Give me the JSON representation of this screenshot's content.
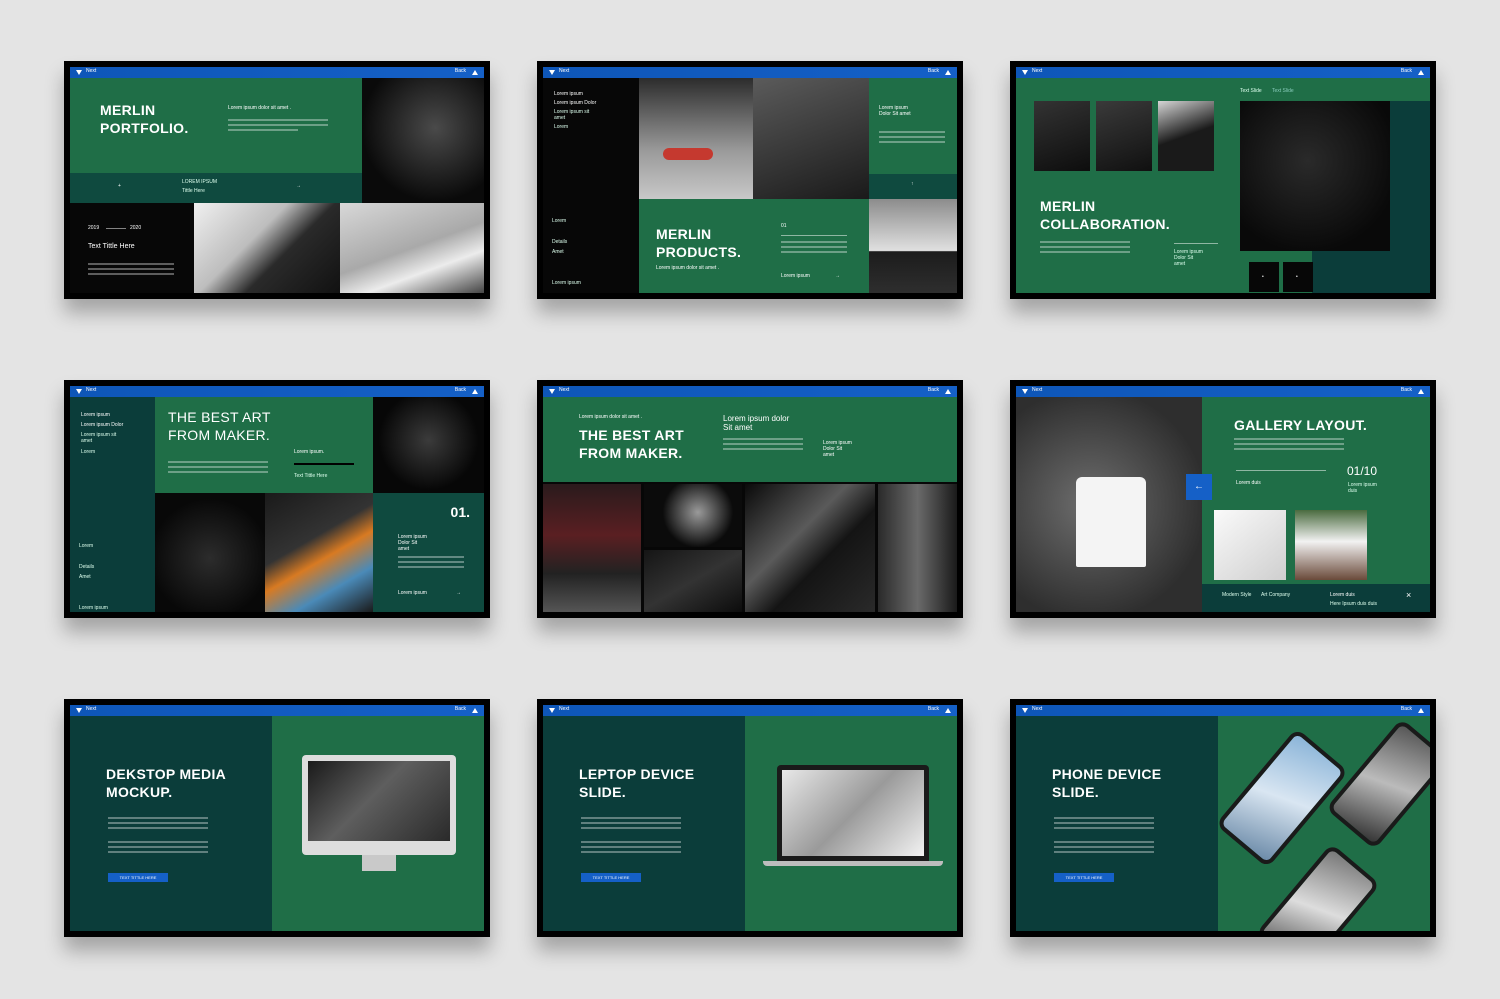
{
  "topbar": {
    "next": "Next",
    "back": "Back"
  },
  "slide1": {
    "title_line1": "MERLIN",
    "title_line2": "PORTFOLIO.",
    "bullet": "Lorem ipsum dolor sit amet .",
    "caption": "LOREM IPSUM",
    "caption_sub": "Tittle Here",
    "year_start": "2019",
    "year_end": "2020",
    "text_title": "Text Tittle Here"
  },
  "slide2": {
    "menu": [
      "Lorem ipsum",
      "Lorem ipsum Dolor",
      "Lorem ipsum sit amet",
      "Lorem"
    ],
    "side_labels": [
      "Lorem",
      "Details",
      "Amet",
      "Lorem ipsum"
    ],
    "right_caption": "Lorem ipsum Dolor Sit amet",
    "title_line1": "MERLIN",
    "title_line2": "PRODUCTS.",
    "bullet": "Lorem ipsum dolor sit amet .",
    "number": "01",
    "link": "Lorem ipsum"
  },
  "slide3": {
    "tabs": [
      "Text Slide",
      "Text Slide"
    ],
    "title_line1": "MERLIN",
    "title_line2": "COLLABORATION.",
    "caption": "Lorem ipsum Dolor Sit amet"
  },
  "slide4": {
    "menu": [
      "Lorem ipsum",
      "Lorem ipsum Dolor",
      "Lorem ipsum sit amet",
      "Lorem"
    ],
    "title_line1": "THE BEST ART",
    "title_line2": "FROM MAKER.",
    "label": "Lorem ipsum.",
    "label_sub": "Text Tittle Here",
    "side_labels": [
      "Lorem",
      "Details",
      "Amet",
      "Lorem ipsum"
    ],
    "number": "01.",
    "caption": "Lorem ipsum Dolor Sit amet",
    "link": "Lorem ipsum"
  },
  "slide5": {
    "bullet": "Lorem ipsum dolor sit amet .",
    "title_line1": "THE BEST ART",
    "title_line2": "FROM MAKER.",
    "heading_line1": "Lorem ipsum dolor",
    "heading_line2": "Sit amet",
    "caption": "Lorem ipsum Dolor Sit amet"
  },
  "slide6": {
    "title": "GALLERY LAYOUT.",
    "counter": "01/10",
    "label": "Lorem duis",
    "label_right": "Lorem ipsum duis",
    "footer": [
      "Modern Style",
      "Art Company",
      "Lorem duis"
    ],
    "footer_sub": "Here Ipsum duis duis"
  },
  "slide7": {
    "title_line1": "DEKSTOP MEDIA",
    "title_line2": "MOCKUP.",
    "button": "TEXT TITTLE HERE"
  },
  "slide8": {
    "title_line1": "LEPTOP DEVICE",
    "title_line2": "SLIDE.",
    "button": "TEXT TITTLE HERE"
  },
  "slide9": {
    "title_line1": "PHONE DEVICE",
    "title_line2": "SLIDE.",
    "button": "TEXT TITTLE HERE"
  }
}
